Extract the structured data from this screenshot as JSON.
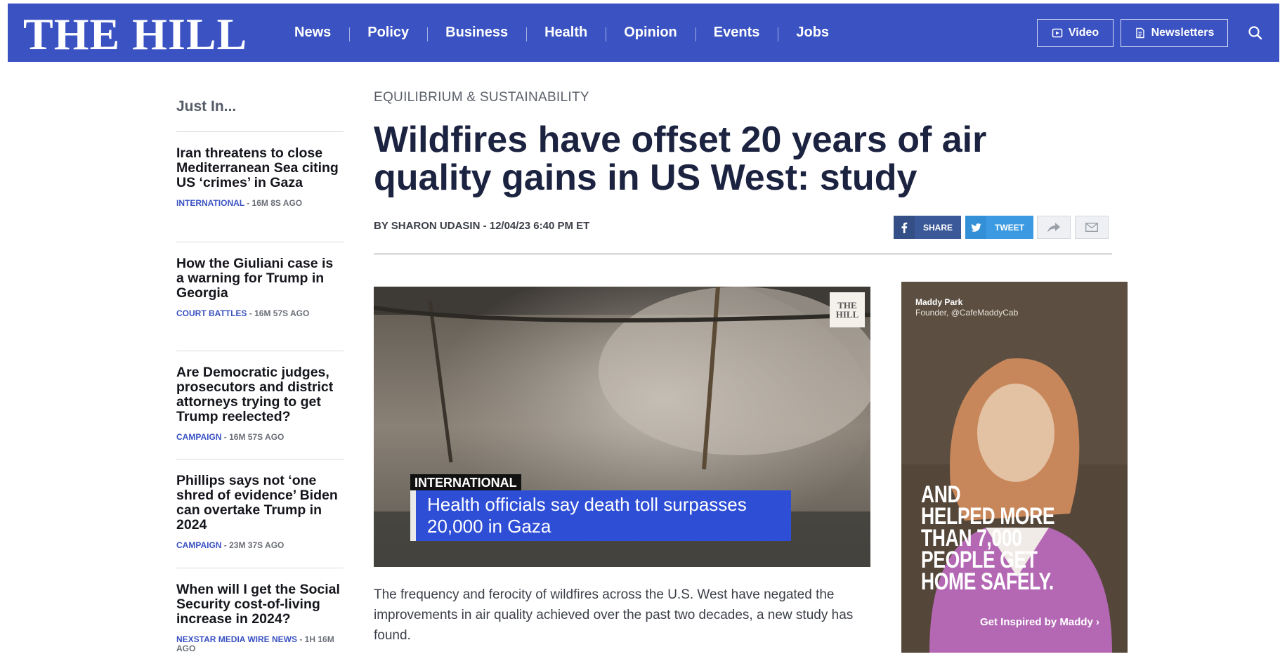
{
  "header": {
    "logo": "THE HILL",
    "nav": [
      "News",
      "Policy",
      "Business",
      "Health",
      "Opinion",
      "Events",
      "Jobs"
    ],
    "video_label": "Video",
    "newsletters_label": "Newsletters",
    "bar_color": "#3a52c2"
  },
  "sidebar": {
    "title": "Just In...",
    "items": [
      {
        "title": "Iran threatens to close Mediterranean Sea citing US ‘crimes’ in Gaza",
        "category": "INTERNATIONAL",
        "time": " - 16M 8S AGO"
      },
      {
        "title": "How the Giuliani case is a warning for Trump in Georgia",
        "category": "COURT BATTLES",
        "time": " - 16M 57S AGO"
      },
      {
        "title": "Are Democratic judges, prosecutors and district attorneys trying to get Trump reelected?",
        "category": "CAMPAIGN",
        "time": " - 16M 57S AGO"
      },
      {
        "title": "Phillips says not ‘one shred of evidence’ Biden can overtake Trump in 2024",
        "category": "CAMPAIGN",
        "time": " - 23M 37S AGO"
      },
      {
        "title": "When will I get the Social Security cost-of-living increase in 2024?",
        "category": "NEXSTAR MEDIA WIRE NEWS",
        "time": " - 1H 16M AGO"
      }
    ]
  },
  "article": {
    "kicker": "EQUILIBRIUM & SUSTAINABILITY",
    "headline": "Wildfires have offset 20 years of air quality gains in US West: study",
    "byline": "BY SHARON UDASIN - 12/04/23 6:40 PM ET",
    "share_label": "SHARE",
    "tweet_label": "TWEET",
    "lede": "The frequency and ferocity of wildfires across the U.S. West have negated the improvements in air quality achieved over the past two decades, a new study has found."
  },
  "video": {
    "watermark": "THE HILL",
    "tag": "INTERNATIONAL",
    "caption": "Health officials say death toll surpasses 20,000 in Gaza"
  },
  "ad": {
    "name": "Maddy Park",
    "subtitle": "Founder, @CafeMaddyCab",
    "headline": "AND\nHELPED MORE\n        THAN 7,000\nPEOPLE GET\n     HOME SAFELY.",
    "cta": "Get Inspired by Maddy ›"
  }
}
